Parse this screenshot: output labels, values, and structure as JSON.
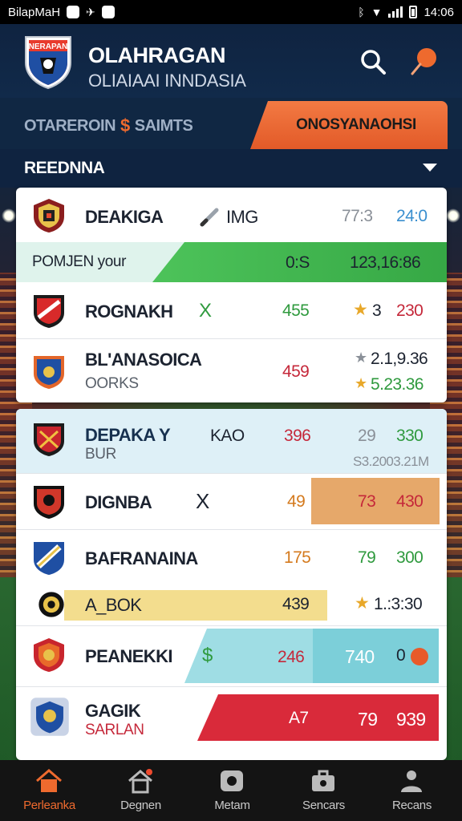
{
  "status_bar": {
    "carrier": "BilapMaH",
    "time": "14:06"
  },
  "header": {
    "logo_text": "NERAPAN",
    "title": "OLAHRAGAN",
    "subtitle": "OLIAIAAI INNDASIA"
  },
  "tabs": {
    "left_label": "OTAREROIN",
    "left_suffix": "SAIMTS",
    "right_label": "ONOSYANAOHSI"
  },
  "section": {
    "title": "REEDNNA"
  },
  "card1": {
    "row1": {
      "name": "DEAKIGA",
      "tag": "IMG",
      "v1": "77:3",
      "v2": "24:0"
    },
    "highlight": {
      "label": "POMJEN your",
      "v1": "0:S",
      "v2": "123,16:86"
    },
    "row2": {
      "name": "ROGNAKH",
      "mark": "X",
      "v1": "455",
      "star": "★",
      "v2": "3",
      "v3": "230"
    },
    "row3": {
      "name": "BL'ANASOICA",
      "sub": "OORKS",
      "v1": "459",
      "v2": "2.1,9.36",
      "v3": "5.23.36"
    }
  },
  "card2": {
    "row1": {
      "name": "DEPAKA Y",
      "sub": "BUR",
      "tag": "KAO",
      "v1": "396",
      "v2": "29",
      "v3": "330",
      "v4": "S3.2003.21M"
    },
    "row2": {
      "name": "DIGNBA",
      "mark": "X",
      "v1": "49",
      "v2": "73",
      "v3": "430"
    },
    "row3": {
      "name": "BAFRANAINA",
      "v1": "175",
      "v2": "79",
      "v3": "300"
    },
    "row4": {
      "name": "A_BOK",
      "v1": "439",
      "v2": "1.:3:30"
    },
    "row5": {
      "name": "PEANEKKI",
      "mark": "$",
      "v1": "246",
      "v2": "740",
      "v3": "0"
    },
    "row6": {
      "name": "GAGIK",
      "sub": "SARLAN",
      "v1": "A7",
      "v2": "79",
      "v3": "939"
    }
  },
  "bottom_nav": [
    {
      "label": "Perleanka",
      "icon": "home-icon"
    },
    {
      "label": "Degnen",
      "icon": "house-notification-icon"
    },
    {
      "label": "Metam",
      "icon": "camera-icon"
    },
    {
      "label": "Sencars",
      "icon": "briefcase-icon"
    },
    {
      "label": "Recans",
      "icon": "person-icon"
    }
  ],
  "colors": {
    "accent": "#ee6a2e",
    "header": "#0f2340",
    "green": "#2f9a3e",
    "red": "#c5283a"
  }
}
